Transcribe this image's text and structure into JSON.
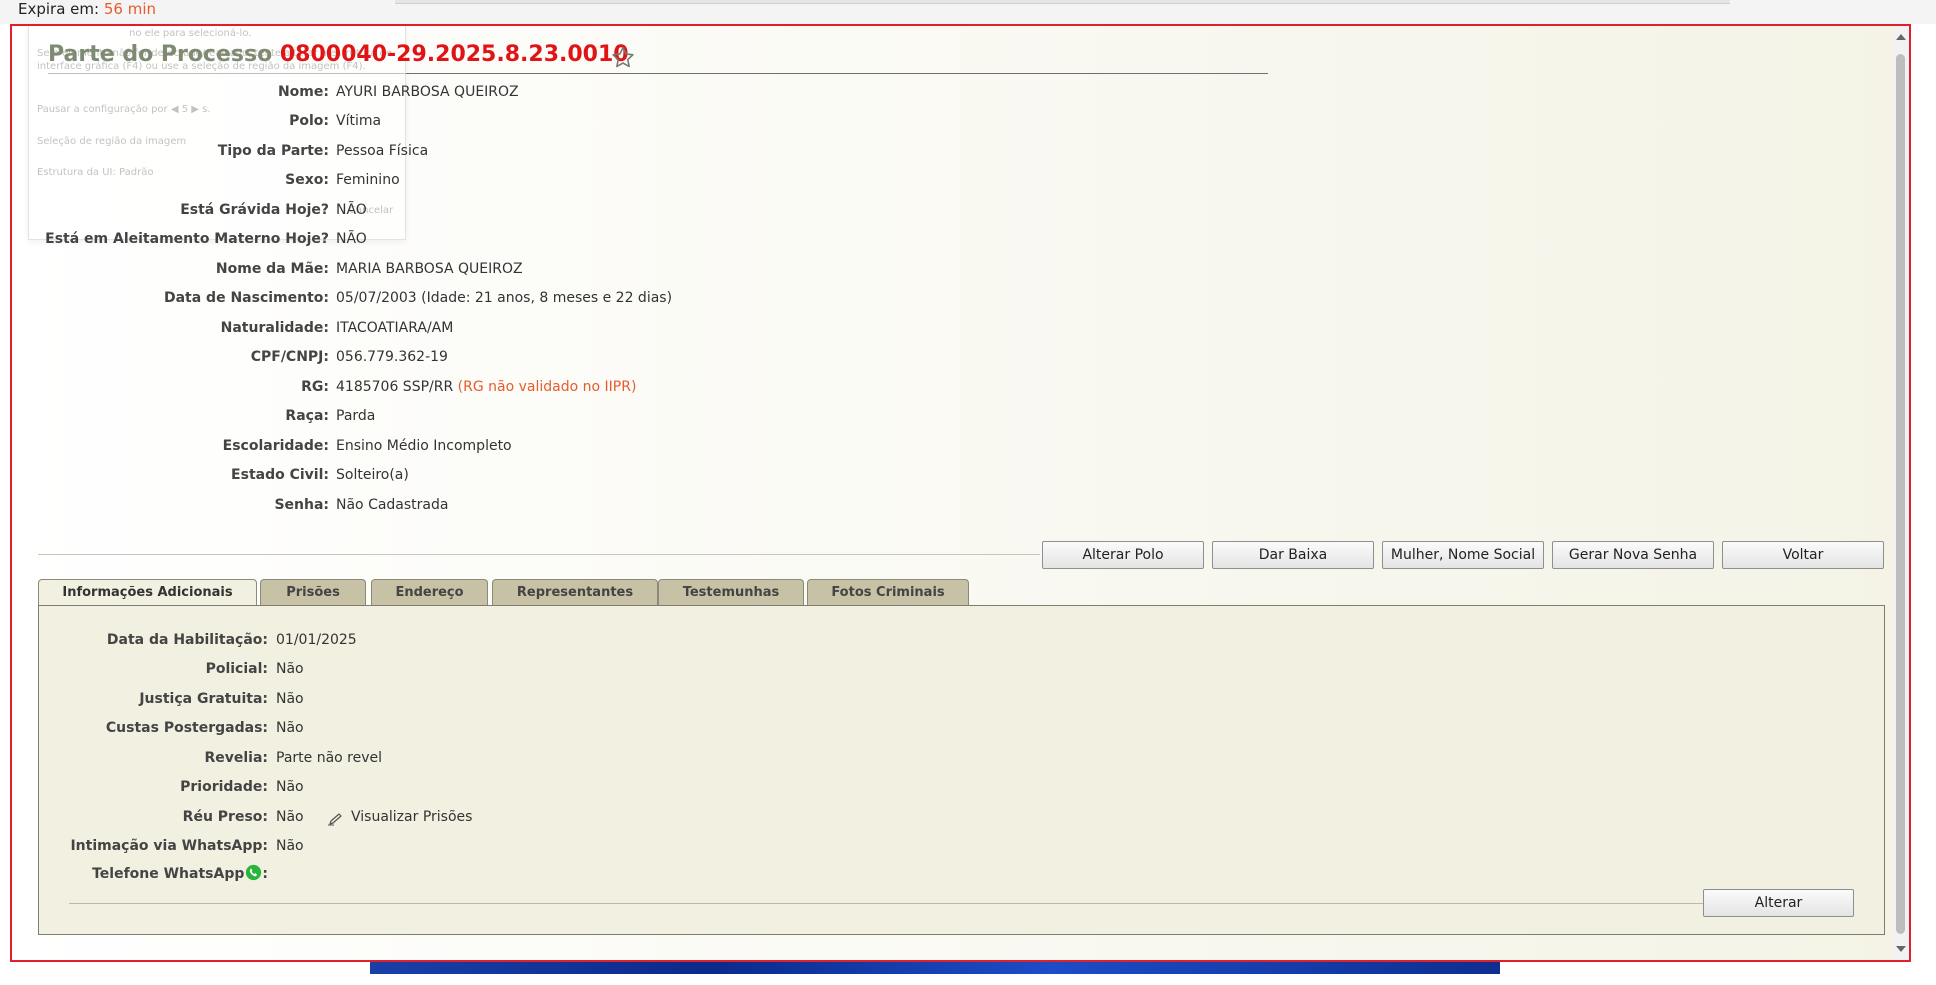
{
  "session": {
    "expira_label": "Expira em:",
    "expira_value": "56 min"
  },
  "ghost_overlay": {
    "lines": [
      "no ele para selecioná-lo.",
      "Se o elemento não for detectado/realçado, tente alterar a estrutura de",
      "interface gráfica (F4) ou use a seleção de região da imagem (F4).",
      "Pausar a configuração por ◀ 5 ▶ s.",
      "Seleção de região da imagem",
      "Estrutura da UI: Padrão",
      "Cancelar"
    ]
  },
  "header": {
    "title_prefix": "Parte do Processo",
    "process_number": "0800040-29.2025.8.23.0010"
  },
  "details": [
    {
      "label": "Nome:",
      "value": "AYURI BARBOSA QUEIROZ"
    },
    {
      "label": "Polo:",
      "value": "Vítima"
    },
    {
      "label": "Tipo da Parte:",
      "value": "Pessoa Física"
    },
    {
      "label": "Sexo:",
      "value": "Feminino"
    },
    {
      "label": "Está Grávida Hoje?",
      "value": "NÃO"
    },
    {
      "label": "Está em Aleitamento Materno Hoje?",
      "value": "NÃO"
    },
    {
      "label": "Nome da Mãe:",
      "value": "MARIA BARBOSA QUEIROZ"
    },
    {
      "label": "Data de Nascimento:",
      "value": "05/07/2003 (Idade: 21 anos, 8 meses e 22 dias)"
    },
    {
      "label": "Naturalidade:",
      "value": "ITACOATIARA/AM"
    },
    {
      "label": "CPF/CNPJ:",
      "value": "056.779.362-19"
    },
    {
      "label": "RG:",
      "value": "4185706 SSP/RR",
      "warning": "(RG não validado no IIPR)"
    },
    {
      "label": "Raça:",
      "value": "Parda"
    },
    {
      "label": "Escolaridade:",
      "value": "Ensino Médio Incompleto"
    },
    {
      "label": "Estado Civil:",
      "value": "Solteiro(a)"
    },
    {
      "label": "Senha:",
      "value": "Não Cadastrada"
    }
  ],
  "actions": {
    "alterar_polo": "Alterar Polo",
    "dar_baixa": "Dar Baixa",
    "nome_social": "Mulher, Nome Social",
    "gerar_senha": "Gerar Nova Senha",
    "voltar": "Voltar"
  },
  "tabs": [
    {
      "label": "Informações Adicionais",
      "active": true
    },
    {
      "label": "Prisões"
    },
    {
      "label": "Endereço"
    },
    {
      "label": "Representantes"
    },
    {
      "label": "Testemunhas"
    },
    {
      "label": "Fotos Criminais"
    }
  ],
  "info": [
    {
      "label": "Data da Habilitação:",
      "value": "01/01/2025"
    },
    {
      "label": "Policial:",
      "value": "Não"
    },
    {
      "label": "Justiça Gratuita:",
      "value": "Não"
    },
    {
      "label": "Custas Postergadas:",
      "value": "Não"
    },
    {
      "label": "Revelia:",
      "value": "Parte não revel"
    },
    {
      "label": "Prioridade:",
      "value": "Não"
    },
    {
      "label": "Réu Preso:",
      "value": "Não"
    },
    {
      "label": "Intimação via WhatsApp:",
      "value": "Não"
    },
    {
      "label": "Telefone WhatsApp",
      "value": ""
    }
  ],
  "visualizar_prisoes": "Visualizar Prisões",
  "alterar": "Alterar",
  "colors": {
    "accent_red": "#e01414",
    "warning_orange": "#e85c2c",
    "title_gray": "#7f8a73",
    "panel_bg": "#f1f0e1",
    "tab_bg": "#c7c2a5"
  }
}
